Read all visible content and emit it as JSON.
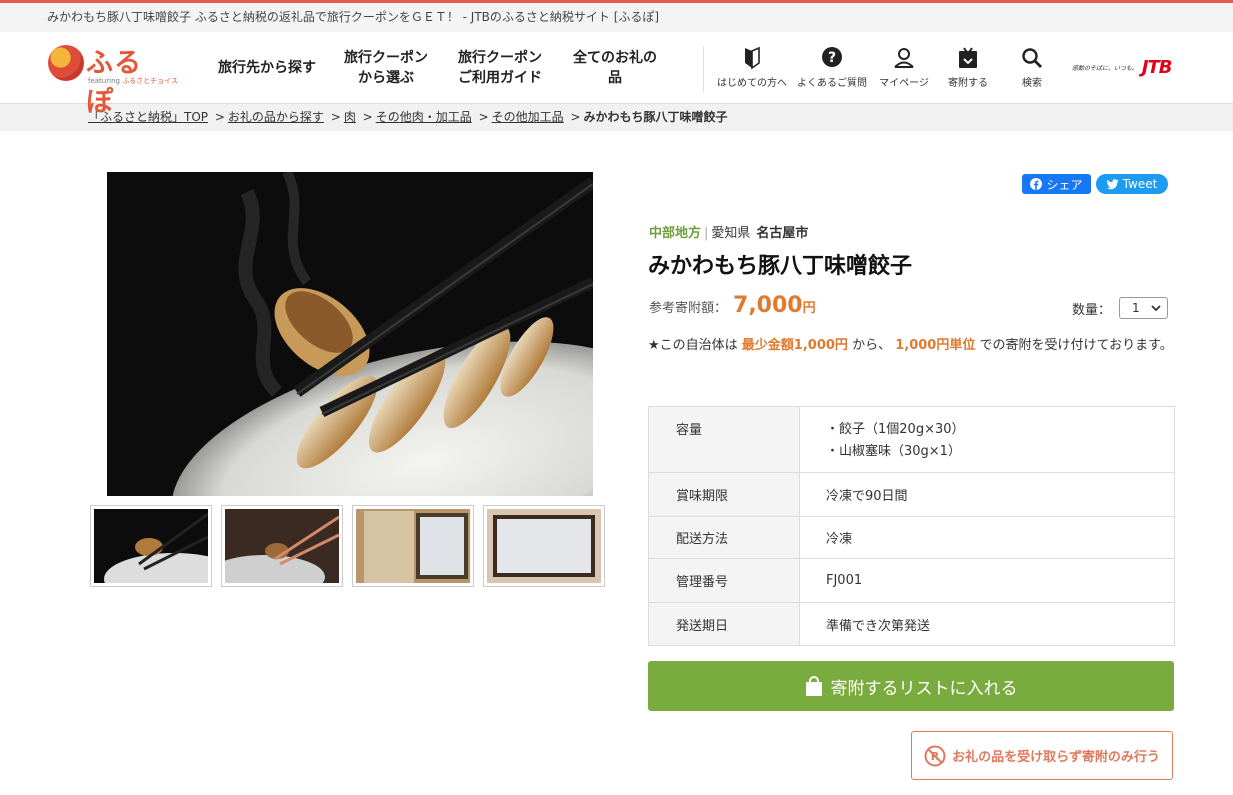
{
  "page_title": "みかわもち豚八丁味噌餃子 ふるさと納税の返礼品で旅行クーポンをＧＥＴ！ - JTBのふるさと納税サイト [ふるぽ]",
  "logo": {
    "name": "ふるぽ",
    "sub_prefix": "featuring",
    "sub_brand": "ふるさとチョイス"
  },
  "gnav": [
    {
      "label": "旅行先から探す"
    },
    {
      "label": "旅行クーポン\nから選ぶ"
    },
    {
      "label": "旅行クーポン\nご利用ガイド"
    },
    {
      "label": "全てのお礼の品"
    }
  ],
  "unav": [
    {
      "label": "はじめての方へ",
      "icon": "beginner-mark-icon"
    },
    {
      "label": "よくあるご質問",
      "icon": "question-icon"
    },
    {
      "label": "マイページ",
      "icon": "user-icon"
    },
    {
      "label": "寄附する",
      "icon": "donate-box-icon"
    },
    {
      "label": "検索",
      "icon": "search-icon"
    }
  ],
  "jtb": {
    "slogan": "感動のそばに、いつも。",
    "logo": "JTB"
  },
  "breadcrumb": [
    "「ふるさと納税」TOP",
    "お礼の品から探す",
    "肉",
    "その他肉・加工品",
    "その他加工品"
  ],
  "breadcrumb_current": "みかわもち豚八丁味噌餃子",
  "share": {
    "facebook": "シェア",
    "twitter": "Tweet"
  },
  "product": {
    "region": "中部地方",
    "prefecture": "愛知県",
    "city": "名古屋市",
    "title": "みかわもち豚八丁味噌餃子",
    "price_label": "参考寄附額：",
    "price": "7,000",
    "price_unit": "円",
    "qty_label": "数量：",
    "qty_value": "1",
    "note_pre": "★この自治体は",
    "note_min": "最少金額1,000円",
    "note_mid": "から、",
    "note_unit": "1,000円単位",
    "note_post": "での寄附を受け付けております。"
  },
  "spec": [
    {
      "key": "容量",
      "values": [
        "・餃子（1個20g×30）",
        "・山椒塞味（30g×1）"
      ]
    },
    {
      "key": "賞味期限",
      "values": [
        "冷凍で90日間"
      ]
    },
    {
      "key": "配送方法",
      "values": [
        "冷凍"
      ]
    },
    {
      "key": "管理番号",
      "values": [
        "FJ001"
      ]
    },
    {
      "key": "発送期日",
      "values": [
        "準備でき次第発送"
      ]
    }
  ],
  "cart_button": "寄附するリストに入れる",
  "donate_only_button": "お礼の品を受け取らず寄附のみ行う",
  "colors": {
    "accent": "#7aab3e",
    "price": "#e07a2e",
    "region": "#6e9e3d",
    "facebook": "#1877f2",
    "twitter": "#1d9bf0",
    "jtb": "#e3001b"
  }
}
